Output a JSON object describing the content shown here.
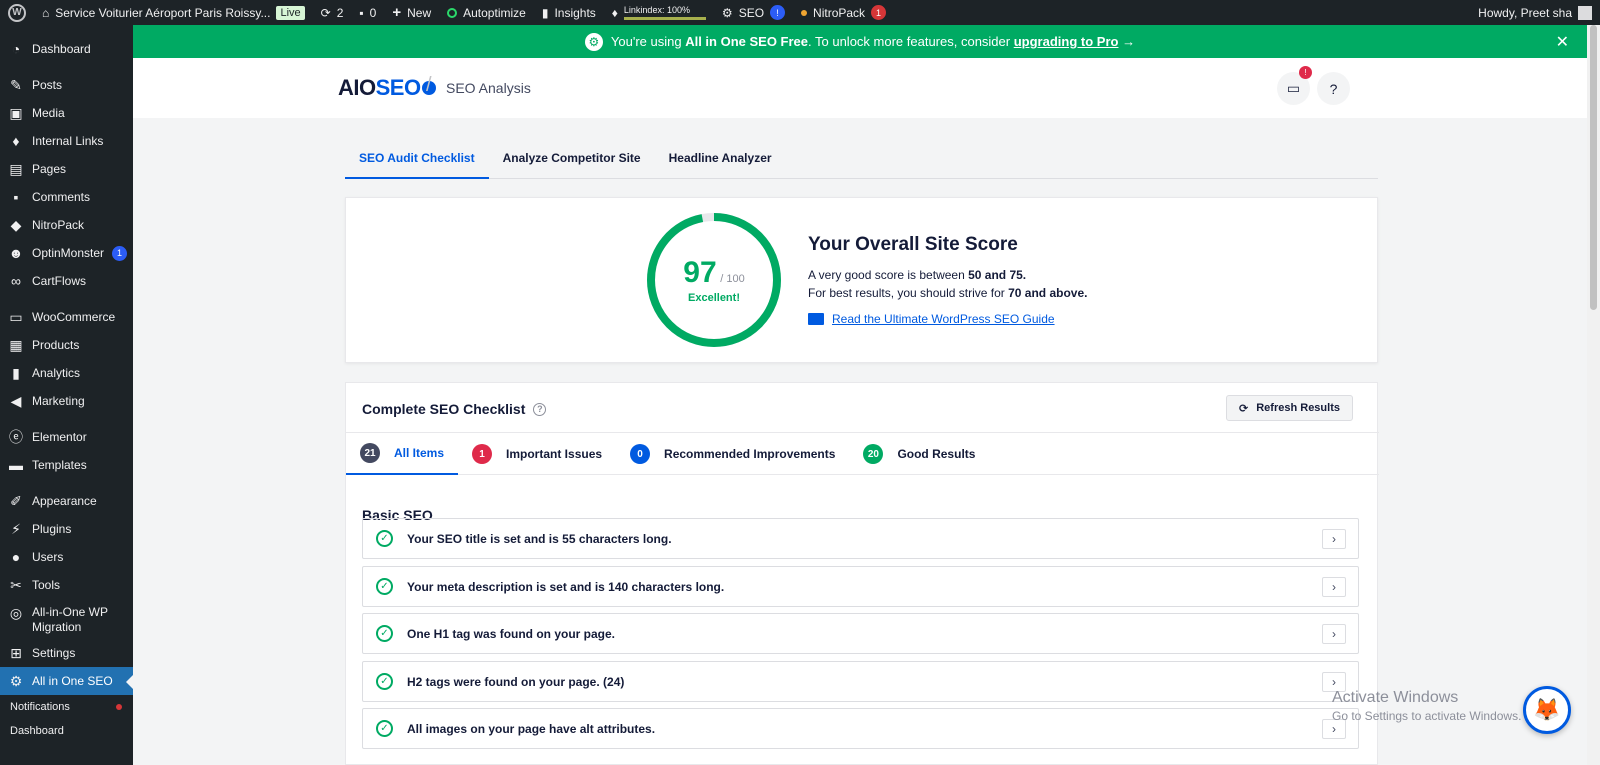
{
  "adminbar": {
    "site_name": "Service Voiturier Aéroport Paris Roissy...",
    "live_label": "Live",
    "updates_count": "2",
    "comments_count": "0",
    "new_label": "New",
    "autoptimize_label": "Autoptimize",
    "insights_label": "Insights",
    "linkindex_label": "Linkindex: 100%",
    "seo_label": "SEO",
    "seo_badge": "!",
    "nitropack_label": "NitroPack",
    "nitropack_badge": "1",
    "howdy": "Howdy, Preet sha"
  },
  "sidebar": {
    "items": [
      {
        "label": "Dashboard",
        "icon": "dashboard-icon"
      },
      {
        "label": "Posts",
        "icon": "pin-icon"
      },
      {
        "label": "Media",
        "icon": "media-icon"
      },
      {
        "label": "Internal Links",
        "icon": "link-icon"
      },
      {
        "label": "Pages",
        "icon": "pages-icon"
      },
      {
        "label": "Comments",
        "icon": "comment-icon"
      },
      {
        "label": "NitroPack",
        "icon": "nitropack-icon"
      },
      {
        "label": "OptinMonster",
        "icon": "optinmonster-icon",
        "badge": "1"
      },
      {
        "label": "CartFlows",
        "icon": "cartflows-icon"
      },
      {
        "label": "WooCommerce",
        "icon": "woo-icon"
      },
      {
        "label": "Products",
        "icon": "products-icon"
      },
      {
        "label": "Analytics",
        "icon": "analytics-icon"
      },
      {
        "label": "Marketing",
        "icon": "marketing-icon"
      },
      {
        "label": "Elementor",
        "icon": "elementor-icon"
      },
      {
        "label": "Templates",
        "icon": "templates-icon"
      },
      {
        "label": "Appearance",
        "icon": "brush-icon"
      },
      {
        "label": "Plugins",
        "icon": "plugin-icon"
      },
      {
        "label": "Users",
        "icon": "users-icon"
      },
      {
        "label": "Tools",
        "icon": "wrench-icon"
      },
      {
        "label": "All-in-One WP",
        "label2": "Migration",
        "icon": "migration-icon"
      },
      {
        "label": "Settings",
        "icon": "settings-icon"
      },
      {
        "label": "All in One SEO",
        "icon": "aioseo-icon"
      }
    ],
    "submenu": [
      {
        "label": "Notifications"
      },
      {
        "label": "Dashboard"
      }
    ]
  },
  "notice": {
    "prefix": "You're using",
    "product": "All in One SEO Free",
    "middle": ". To unlock more features, consider",
    "link": "upgrading to Pro",
    "arrow": "→",
    "close": "✕"
  },
  "header": {
    "logo_aio": "AIO",
    "logo_seo": "SEO",
    "page_title": "SEO Analysis",
    "notif_badge": "!"
  },
  "tabs": [
    {
      "label": "SEO Audit Checklist"
    },
    {
      "label": "Analyze Competitor Site"
    },
    {
      "label": "Headline Analyzer"
    }
  ],
  "score": {
    "value": 97,
    "max": 100,
    "value_label": "97",
    "max_label": "/ 100",
    "rating": "Excellent!",
    "heading": "Your Overall Site Score",
    "line1_pre": "A very good score is between ",
    "line1_bold": "50 and 75.",
    "line2_pre": "For best results, you should strive for ",
    "line2_bold": "70 and above.",
    "guide_link": "Read the Ultimate WordPress SEO Guide",
    "color": "#00aa63"
  },
  "checklist": {
    "title": "Complete SEO Checklist",
    "refresh_label": "Refresh Results",
    "filters": [
      {
        "count": "21",
        "label": "All Items",
        "color": "#434960"
      },
      {
        "count": "1",
        "label": "Important Issues",
        "color": "#df2a4a"
      },
      {
        "count": "0",
        "label": "Recommended Improvements",
        "color": "#005ae0"
      },
      {
        "count": "20",
        "label": "Good Results",
        "color": "#00aa63"
      }
    ],
    "section_title": "Basic SEO",
    "rows": [
      {
        "text": "Your SEO title is set and is 55 characters long."
      },
      {
        "text": "Your meta description is set and is 140 characters long."
      },
      {
        "text": "One H1 tag was found on your page."
      },
      {
        "text": "H2 tags were found on your page. (24)"
      },
      {
        "text": "All images on your page have alt attributes."
      }
    ]
  },
  "watermark": {
    "line1": "Activate Windows",
    "line2": "Go to Settings to activate Windows."
  }
}
